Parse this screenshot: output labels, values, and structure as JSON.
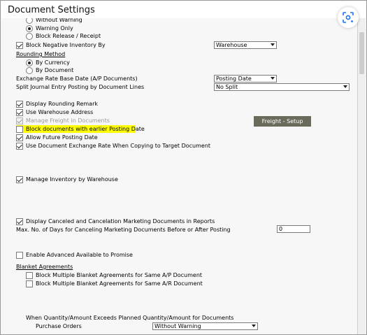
{
  "window": {
    "title": "Document Settings"
  },
  "inventory": {
    "radio_without_warning": "Without Warning",
    "radio_warning_only": "Warning Only",
    "radio_block_release": "Block Release / Receipt",
    "block_negative_label": "Block Negative Inventory By",
    "block_negative_value": "Warehouse"
  },
  "rounding": {
    "heading": "Rounding Method",
    "by_currency": "By Currency",
    "by_document": "By Document"
  },
  "exchange": {
    "label": "Exchange Rate Base Date (A/P Documents)",
    "value": "Posting Date"
  },
  "split_journal": {
    "label": "Split Journal Entry Posting by Document Lines",
    "value": "No Split"
  },
  "options": {
    "display_rounding": "Display Rounding Remark",
    "use_warehouse": "Use Warehouse Address",
    "manage_freight": "Manage Freight in Documents",
    "block_earlier": "Block documents with earlier Posting Date",
    "allow_future": "Allow Future Posting Date",
    "use_doc_exchange": "Use Document Exchange Rate When Copying to Target Document",
    "freight_setup": "Freight - Setup"
  },
  "warehouse": {
    "manage_inventory": "Manage Inventory by Warehouse"
  },
  "canceled": {
    "display_label": "Display Canceled and Cancelation Marketing Documents in Reports",
    "max_days_label": "Max. No. of Days for Canceling Marketing Documents Before or After Posting",
    "max_days_value": "0"
  },
  "atp": {
    "label": "Enable Advanced Available to Promise"
  },
  "blanket": {
    "heading": "Blanket Agreements",
    "ap": "Block Multiple Blanket Agreements for Same A/P Document",
    "ar": "Block Multiple Blanket Agreements for Same A/R Document"
  },
  "planned": {
    "label": "When Quantity/Amount Exceeds Planned Quantity/Amount for Documents",
    "po_label": "Purchase Orders",
    "po_value": "Without Warning"
  }
}
